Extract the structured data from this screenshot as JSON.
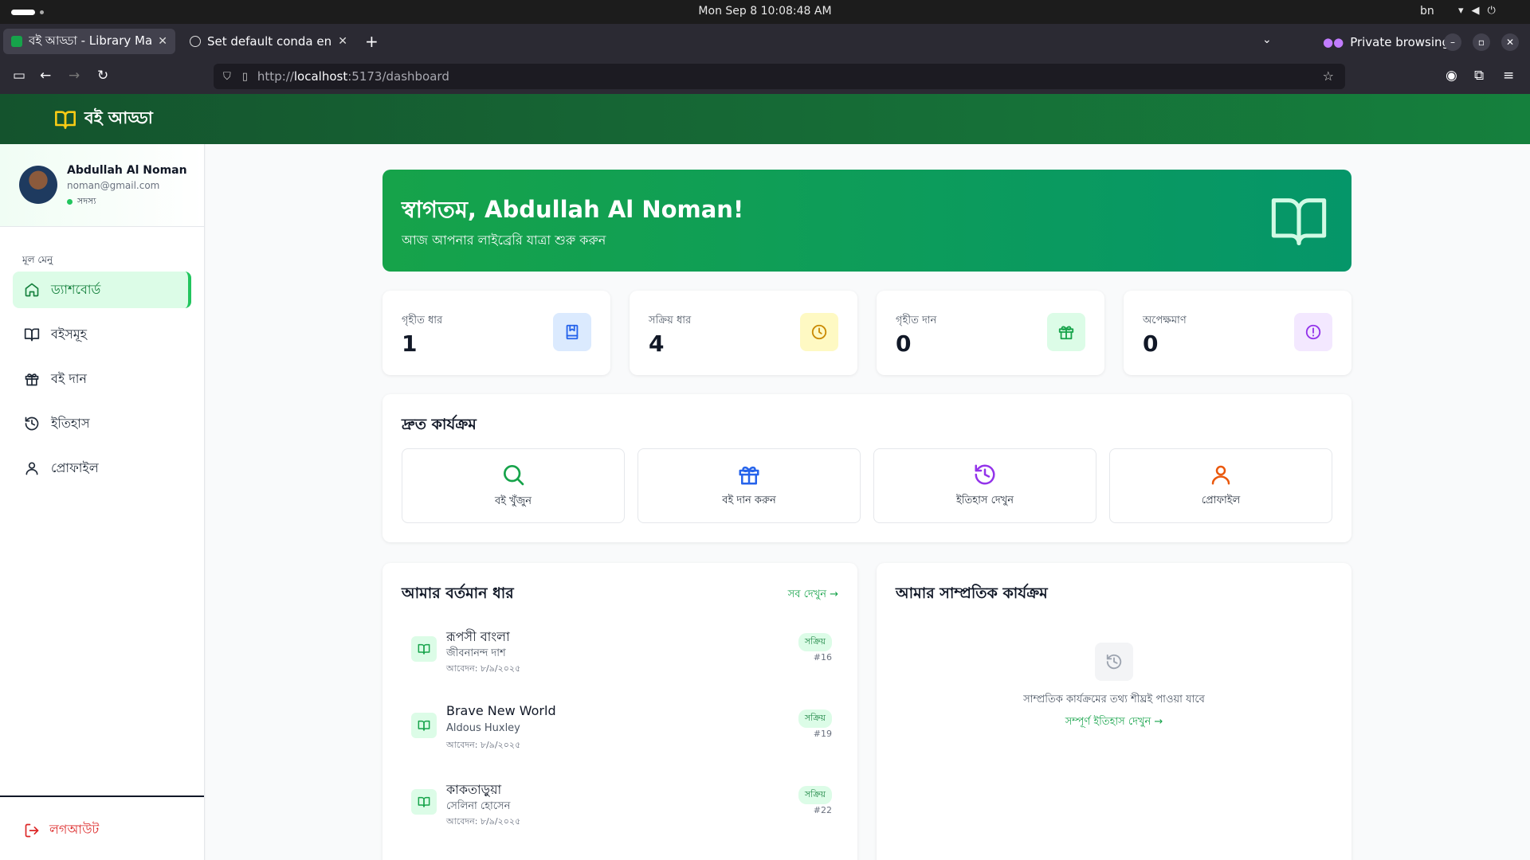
{
  "os": {
    "clock": "Mon Sep 8  10:08:48 AM",
    "lang": "bn"
  },
  "browser": {
    "tabs": [
      {
        "title": "বই আড্ডা - Library Management",
        "active": true
      },
      {
        "title": "Set default conda env",
        "active": false
      }
    ],
    "private_label": "Private browsing",
    "url_prefix": "http://",
    "url_host": "localhost",
    "url_rest": ":5173/dashboard"
  },
  "app": {
    "brand": "বই আড্ডা",
    "accent": "#16a34a"
  },
  "user": {
    "name": "Abdullah Al Noman",
    "email": "noman@gmail.com",
    "role": "সদস্য"
  },
  "sidebar": {
    "heading": "মূল মেনু",
    "items": [
      {
        "label": "ড্যাশবোর্ড",
        "icon": "home-icon",
        "active": true
      },
      {
        "label": "বইসমূহ",
        "icon": "book-open-icon",
        "active": false
      },
      {
        "label": "বই দান",
        "icon": "gift-icon",
        "active": false
      },
      {
        "label": "ইতিহাস",
        "icon": "history-icon",
        "active": false
      },
      {
        "label": "প্রোফাইল",
        "icon": "user-icon",
        "active": false
      }
    ],
    "logout": "লগআউট"
  },
  "hero": {
    "title": "স্বাগতম, Abdullah Al Noman!",
    "subtitle": "আজ আপনার লাইব্রেরি যাত্রা শুরু করুন"
  },
  "stats": [
    {
      "label": "গৃহীত ধার",
      "value": "1",
      "icon": "bookmark-book-icon",
      "color": "#2563eb",
      "bg": "#dbeafe"
    },
    {
      "label": "সক্রিয় ধার",
      "value": "4",
      "icon": "clock-icon",
      "color": "#ca8a04",
      "bg": "#fef9c3"
    },
    {
      "label": "গৃহীত দান",
      "value": "0",
      "icon": "gift-icon",
      "color": "#16a34a",
      "bg": "#dcfce7"
    },
    {
      "label": "অপেক্ষমাণ",
      "value": "0",
      "icon": "alert-circle-icon",
      "color": "#9333ea",
      "bg": "#f3e8ff"
    }
  ],
  "quick_actions": {
    "title": "দ্রুত কার্যক্রম",
    "items": [
      {
        "label": "বই খুঁজুন",
        "icon": "search-icon",
        "color": "#16a34a"
      },
      {
        "label": "বই দান করুন",
        "icon": "gift-icon",
        "color": "#2563eb"
      },
      {
        "label": "ইতিহাস দেখুন",
        "icon": "history-icon",
        "color": "#9333ea"
      },
      {
        "label": "প্রোফাইল",
        "icon": "user-icon",
        "color": "#ea580c"
      }
    ]
  },
  "loans": {
    "title": "আমার বর্তমান ধার",
    "see_all": "সব দেখুন →",
    "items": [
      {
        "title": "রূপসী বাংলা",
        "author": "জীবনানন্দ দাশ",
        "date": "আবেদন: ৮/৯/২০২৫",
        "status": "সক্রিয়",
        "id": "#16"
      },
      {
        "title": "Brave New World",
        "author": "Aldous Huxley",
        "date": "আবেদন: ৮/৯/২০২৫",
        "status": "সক্রিয়",
        "id": "#19"
      },
      {
        "title": "কাকতাড়ুয়া",
        "author": "সেলিনা হোসেন",
        "date": "আবেদন: ৮/৯/২০২৫",
        "status": "সক্রিয়",
        "id": "#22"
      }
    ]
  },
  "activity": {
    "title": "আমার সাম্প্রতিক কার্যক্রম",
    "empty_text": "সাম্প্রতিক কার্যক্রমের তথ্য শীঘ্রই পাওয়া যাবে",
    "link": "সম্পূর্ণ ইতিহাস দেখুন →"
  }
}
